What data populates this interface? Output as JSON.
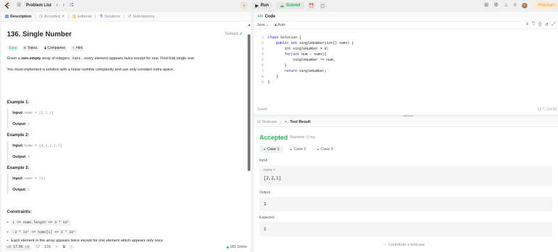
{
  "topbar": {
    "problem_list_label": "Problem List",
    "run_label": "Run",
    "submit_label": "Submit",
    "streak_count": "0",
    "premium_label": "Premium"
  },
  "left": {
    "tabs": [
      {
        "label": "Description",
        "active": true
      },
      {
        "label": "Accepted",
        "active": false
      },
      {
        "label": "Editorial",
        "active": false
      },
      {
        "label": "Solutions",
        "active": false
      },
      {
        "label": "Submissions",
        "active": false
      }
    ],
    "title": "136. Single Number",
    "solved_label": "Solved",
    "chips": {
      "difficulty": "Easy",
      "topics": "Topics",
      "companies": "Companies",
      "hint": "Hint"
    },
    "desc": {
      "p1_a": "Given a ",
      "p1_b": "non-empty",
      "p1_c": " array of integers ",
      "p1_code": "nums",
      "p1_d": ", every element appears ",
      "p1_e": "twice",
      "p1_f": " except for one. Find that single one.",
      "p2": "You must implement a solution with a linear runtime complexity and use only constant extra space."
    },
    "examples": [
      {
        "title": "Example 1:",
        "input_label": "Input:",
        "input": "nums = [2,2,1]",
        "output_label": "Output:",
        "output": "1"
      },
      {
        "title": "Example 2:",
        "input_label": "Input:",
        "input": "nums = [4,1,2,1,2]",
        "output_label": "Output:",
        "output": "4"
      },
      {
        "title": "Example 3:",
        "input_label": "Input:",
        "input": "nums = [1]",
        "output_label": "Output:",
        "output": "1"
      }
    ],
    "constraints_title": "Constraints:",
    "constraints": [
      "1 <= nums.length <= 3 * 10⁴",
      "-3 * 10⁴ <= nums[i] <= 3 * 10⁴",
      "Each element in the array appears twice except for one element which appears only once."
    ],
    "bottom": {
      "likes": "17.3K",
      "comments": "216",
      "online": "182 Online"
    }
  },
  "code": {
    "header": "Code",
    "language": "Java",
    "mode": "Auto",
    "lines": [
      "class Solution {",
      "    public int singleNumber(int[] nums) {",
      "        int singleNumber = 0;",
      "        for(int num : nums){",
      "            singleNumber ^= num;",
      "        }",
      "        return singleNumber;",
      "    }",
      "}"
    ],
    "saved": "Saved",
    "cursor": "Ln 7, Col 29"
  },
  "result": {
    "tab_testcase": "Testcase",
    "tab_result": "Test Result",
    "status": "Accepted",
    "runtime": "Runtime: 0 ms",
    "cases": [
      "Case 1",
      "Case 2",
      "Case 3"
    ],
    "input_label": "Input",
    "input_var": "nums =",
    "input_value": "[2,2,1]",
    "output_label": "Output",
    "output_value": "1",
    "expected_label": "Expected",
    "expected_value": "1",
    "contribute": "Contribute a testcase"
  },
  "colors": {
    "accent_green": "#2db55d",
    "easy": "#00b8a3",
    "premium": "#f09a22"
  }
}
